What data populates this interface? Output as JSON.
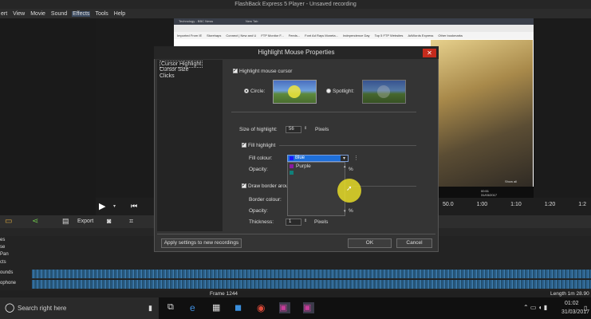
{
  "app": {
    "title": "FlashBack Express 5 Player - Unsaved recording"
  },
  "menu": [
    "ert",
    "View",
    "Movie",
    "Sound",
    "Effects",
    "Tools",
    "Help"
  ],
  "menu_active": "Effects",
  "browser": {
    "tab_label": "Technology - BBC News",
    "tab2_label": "New Tab",
    "bookmarks": [
      "Imported From IE",
      "Storehaps",
      "Connect | New and U",
      "FTP Monitor F...",
      "Feeds...",
      "Font Ad Rays Moneta...",
      "Independence Day",
      "Top 5 FTP Websites",
      "AdWords Express",
      "Other bookmarks"
    ],
    "show_all": "Show all",
    "clock_time": "00:51",
    "clock_date": "31/03/2017"
  },
  "transport": {
    "ruler": [
      "50.0",
      "1:00",
      "1:10",
      "1:20",
      "1:2"
    ]
  },
  "toolbar": {
    "export_label": "Export"
  },
  "tracks": [
    "es",
    "se",
    "Pan",
    "cts",
    "ounds",
    "ophone"
  ],
  "status": {
    "frame": "Frame 1244",
    "length": "Length 1m 28.90"
  },
  "taskbar": {
    "search_placeholder": "Search right here",
    "time": "01:02",
    "date": "31/03/2017"
  },
  "dialog": {
    "title": "Highlight Mouse Properties",
    "nav": [
      "Cursor Highlight",
      "Cursor Size",
      "Clicks"
    ],
    "highlight_label": "Highlight mouse cursor",
    "circle_label": "Circle:",
    "spotlight_label": "Spotlight:",
    "size_label": "Size of highlight:",
    "size_value": "56",
    "size_unit": "Pixels",
    "fill_label": "Fill highlight",
    "fill_colour_label": "Fill colour:",
    "opacity_label": "Opacity:",
    "opacity_suffix": "%",
    "border_label": "Draw border arou",
    "border_colour_label": "Border colour:",
    "opacity2_label": "Opacity:",
    "opacity2_suffix": "%",
    "thickness_label": "Thickness:",
    "thickness_value": "1",
    "thickness_unit": "Pixels",
    "dropdown_selected": "Blue",
    "dropdown_options": [
      "Purple"
    ],
    "apply_button": "Apply settings to new recordings",
    "ok_button": "OK",
    "cancel_button": "Cancel"
  },
  "colors": {
    "selected": "#1e6fd9",
    "blue": "#1a1aff",
    "purple": "#8a1aa0",
    "teal": "#10807a",
    "highlight": "#e6dc28"
  }
}
